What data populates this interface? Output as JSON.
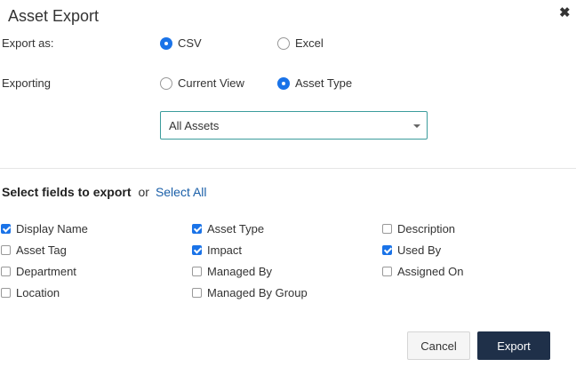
{
  "dialog": {
    "title": "Asset Export",
    "close_glyph": "✖"
  },
  "export_as": {
    "label": "Export as:",
    "options": [
      {
        "label": "CSV",
        "selected": true
      },
      {
        "label": "Excel",
        "selected": false
      }
    ]
  },
  "exporting": {
    "label": "Exporting",
    "options": [
      {
        "label": "Current View",
        "selected": false
      },
      {
        "label": "Asset Type",
        "selected": true
      }
    ],
    "asset_select": {
      "value": "All Assets"
    }
  },
  "fields": {
    "heading": "Select fields to export",
    "or_text": "or",
    "select_all": "Select All",
    "items": [
      {
        "label": "Display Name",
        "checked": true
      },
      {
        "label": "Asset Type",
        "checked": true
      },
      {
        "label": "Description",
        "checked": false
      },
      {
        "label": "Asset Tag",
        "checked": false
      },
      {
        "label": "Impact",
        "checked": true
      },
      {
        "label": "Used By",
        "checked": true
      },
      {
        "label": "Department",
        "checked": false
      },
      {
        "label": "Managed By",
        "checked": false
      },
      {
        "label": "Assigned On",
        "checked": false
      },
      {
        "label": "Location",
        "checked": false
      },
      {
        "label": "Managed By Group",
        "checked": false
      }
    ]
  },
  "buttons": {
    "cancel": "Cancel",
    "export": "Export"
  },
  "colors": {
    "accent": "#1a73e8",
    "primary_button": "#1f3049",
    "link": "#1a5fa8",
    "select_border": "#3b9c9c"
  }
}
